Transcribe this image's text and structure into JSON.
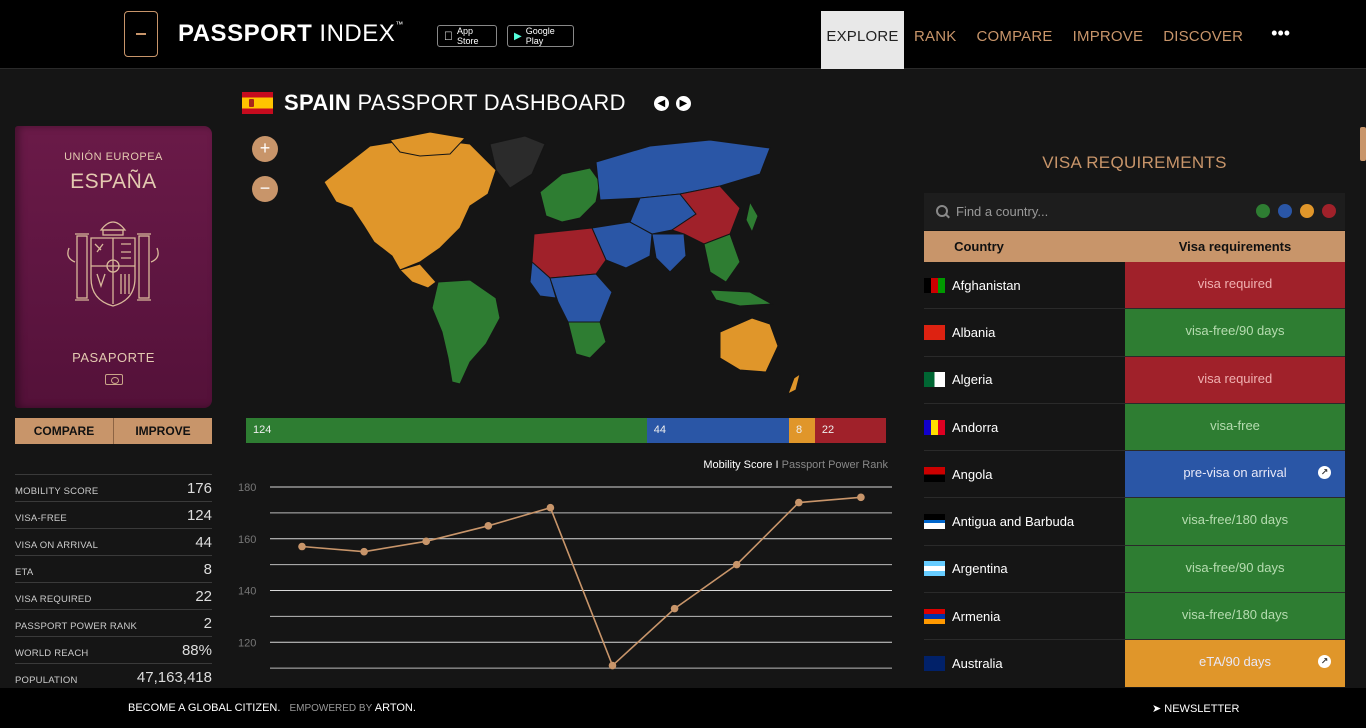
{
  "header": {
    "brand_bold": "PASSPORT",
    "brand_light": "INDEX",
    "brand_tm": "™",
    "app_store": "App Store",
    "google_play": "Google Play",
    "nav": [
      {
        "label": "EXPLORE",
        "active": true
      },
      {
        "label": "RANK"
      },
      {
        "label": "COMPARE"
      },
      {
        "label": "IMPROVE"
      },
      {
        "label": "DISCOVER"
      }
    ],
    "more": "•••"
  },
  "passport": {
    "union": "UNIÓN EUROPEA",
    "country": "ESPAÑA",
    "label": "PASAPORTE",
    "compare_label": "COMPARE",
    "improve_label": "IMPROVE"
  },
  "stats": [
    {
      "label": "MOBILITY SCORE",
      "value": "176"
    },
    {
      "label": "VISA-FREE",
      "value": "124"
    },
    {
      "label": "VISA ON ARRIVAL",
      "value": "44"
    },
    {
      "label": "ETA",
      "value": "8"
    },
    {
      "label": "VISA REQUIRED",
      "value": "22"
    },
    {
      "label": "PASSPORT POWER RANK",
      "value": "2"
    },
    {
      "label": "WORLD REACH",
      "value": "88%"
    },
    {
      "label": "POPULATION",
      "value": "47,163,418"
    }
  ],
  "dashboard": {
    "title_bold": "SPAIN",
    "title_rest": "PASSPORT DASHBOARD",
    "prev": "◀",
    "next": "▶",
    "zoom_in": "+",
    "zoom_out": "−"
  },
  "distribution": [
    {
      "value": 124,
      "color": "#2e7d32"
    },
    {
      "value": 44,
      "color": "#2a56a6"
    },
    {
      "value": 8,
      "color": "#e0962a"
    },
    {
      "value": 22,
      "color": "#a0212a"
    }
  ],
  "legend": {
    "primary": "Mobility Score",
    "separator": "I",
    "secondary": "Passport Power Rank"
  },
  "chart_data": {
    "type": "line",
    "series": [
      {
        "values": [
          157,
          155,
          159,
          165,
          172,
          111,
          133,
          150,
          174,
          176
        ]
      }
    ],
    "ylim": [
      100,
      180
    ],
    "yticks": [
      100,
      120,
      140,
      160,
      180
    ],
    "ytick_labels": [
      "120",
      "140",
      "160",
      "180"
    ],
    "color": "#c8956a"
  },
  "visa": {
    "title": "VISA REQUIREMENTS",
    "search_placeholder": "Find a country...",
    "filter_colors": [
      "#2e7d32",
      "#2a56a6",
      "#e0962a",
      "#a0212a"
    ],
    "col_country": "Country",
    "col_req": "Visa requirements",
    "rows": [
      {
        "country": "Afghanistan",
        "req": "visa required",
        "status": "red",
        "flag": "af"
      },
      {
        "country": "Albania",
        "req": "visa-free/90 days",
        "status": "green",
        "flag": "al"
      },
      {
        "country": "Algeria",
        "req": "visa required",
        "status": "red",
        "flag": "dz"
      },
      {
        "country": "Andorra",
        "req": "visa-free",
        "status": "green",
        "flag": "ad"
      },
      {
        "country": "Angola",
        "req": "pre-visa on arrival",
        "status": "blue",
        "flag": "ao",
        "more": true
      },
      {
        "country": "Antigua and Barbuda",
        "req": "visa-free/180 days",
        "status": "green",
        "flag": "ag"
      },
      {
        "country": "Argentina",
        "req": "visa-free/90 days",
        "status": "green",
        "flag": "ar"
      },
      {
        "country": "Armenia",
        "req": "visa-free/180 days",
        "status": "green",
        "flag": "am"
      },
      {
        "country": "Australia",
        "req": "eTA/90 days",
        "status": "orange",
        "flag": "au",
        "more": true
      }
    ],
    "status_colors": {
      "green": "#2e7d32",
      "blue": "#2a56a6",
      "orange": "#e0962a",
      "red": "#a0212a"
    }
  },
  "footer": {
    "left": "BECOME A GLOBAL CITIZEN.",
    "powered": "EMPOWERED BY",
    "arton": "ARTON.",
    "newsletter": "NEWSLETTER"
  }
}
